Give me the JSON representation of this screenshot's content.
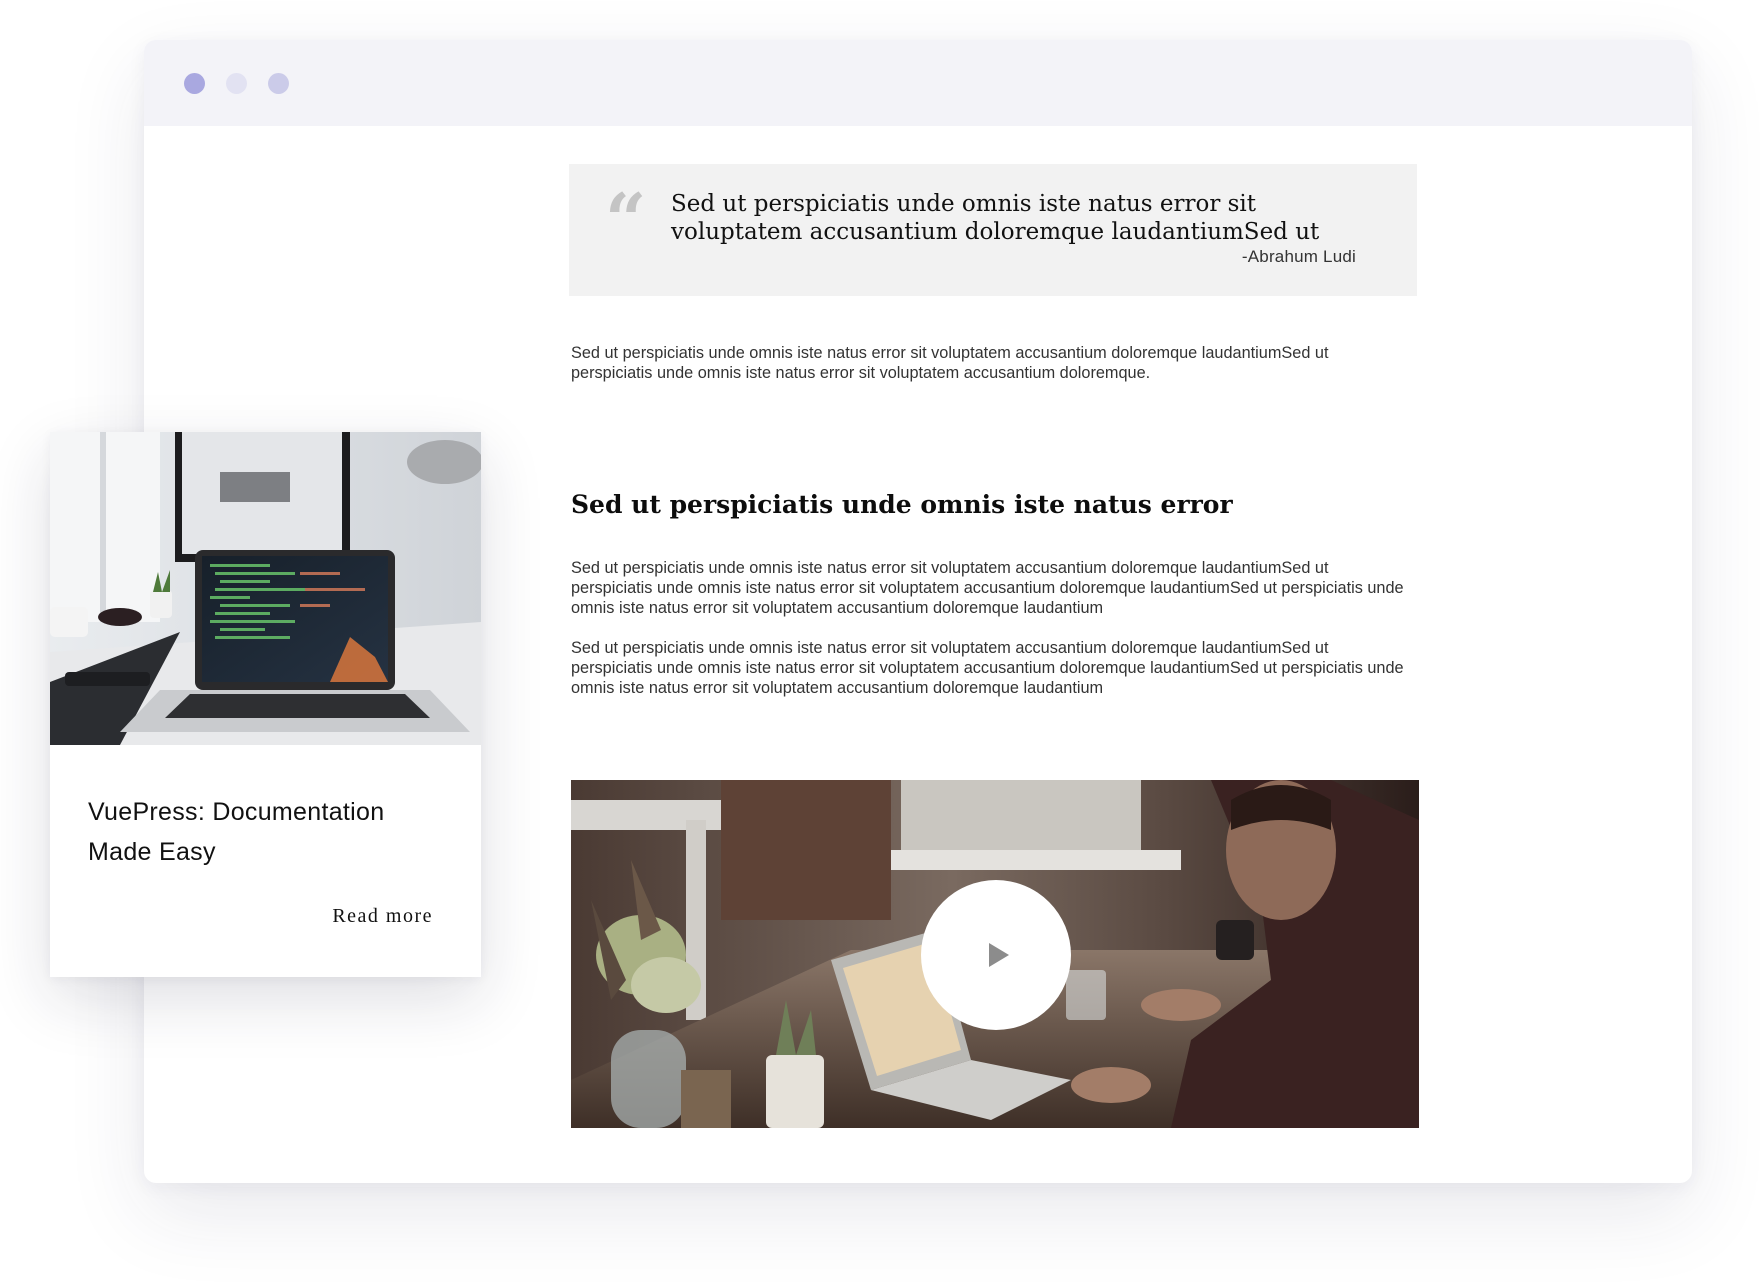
{
  "window": {
    "controls": [
      {
        "name": "close",
        "color": "#a9a8e0"
      },
      {
        "name": "minimize",
        "color": "#e2e2f2"
      },
      {
        "name": "maximize",
        "color": "#cbcbe9"
      }
    ]
  },
  "quote": {
    "mark": "“",
    "text": "Sed ut perspiciatis unde omnis iste natus error sit voluptatem accusantium doloremque laudantiumSed ut",
    "author": "-Abrahum Ludi"
  },
  "article": {
    "intro": "Sed ut perspiciatis unde omnis iste natus error sit voluptatem accusantium doloremque laudantiumSed ut perspiciatis unde omnis iste natus error sit voluptatem accusantium doloremque.",
    "heading": "Sed ut perspiciatis unde omnis iste natus error",
    "paragraphs": [
      "Sed ut perspiciatis unde omnis iste natus error sit voluptatem accusantium doloremque laudantiumSed ut perspiciatis unde omnis iste natus error sit voluptatem accusantium doloremque laudantiumSed ut perspiciatis unde omnis iste natus error sit voluptatem accusantium doloremque laudantium",
      "Sed ut perspiciatis unde omnis iste natus error sit voluptatem accusantium doloremque laudantiumSed ut perspiciatis unde omnis iste natus error sit voluptatem accusantium doloremque laudantiumSed ut perspiciatis unde omnis iste natus error sit voluptatem accusantium doloremque laudantium"
    ],
    "video": {
      "play_icon": "play-icon"
    }
  },
  "card": {
    "image_icon": "laptop-desk-photo",
    "title": "VuePress: Documentation Made Easy",
    "read_more": "Read more"
  }
}
